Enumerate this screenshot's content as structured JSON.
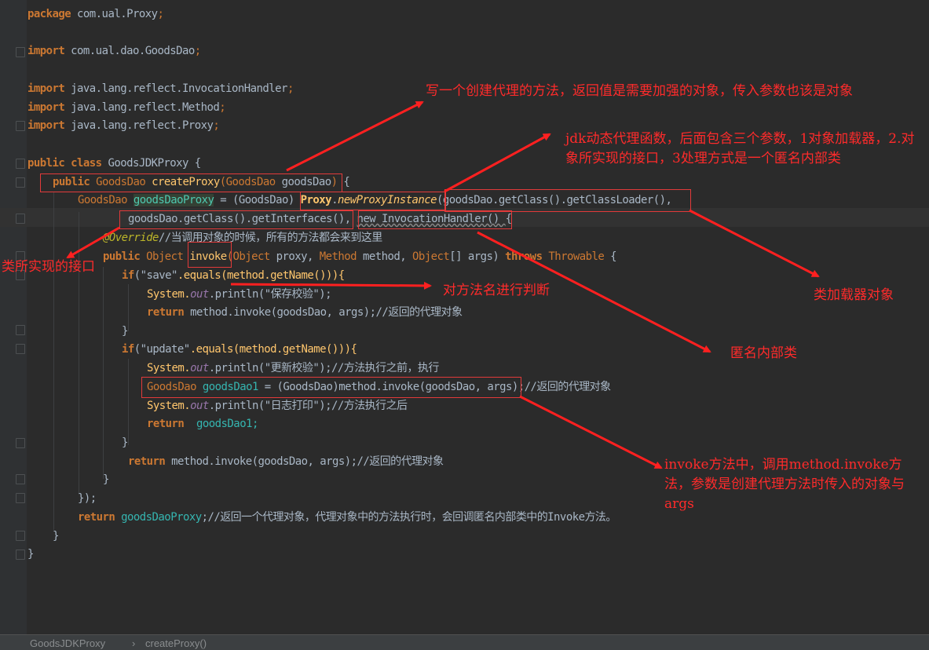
{
  "code": {
    "l1_kw": "package",
    "l1_pkg": "com.ual.Proxy",
    "l1_end": ";",
    "l2_kw": "import",
    "l2_pkg": "com.ual.dao.GoodsDao",
    "l2_end": ";",
    "l3_kw": "import",
    "l3_pkg": "java.lang.reflect.",
    "l3_cls": "InvocationHandler",
    "l3_end": ";",
    "l4_kw": "import",
    "l4_pkg": "java.lang.reflect.",
    "l4_cls": "Method",
    "l4_end": ";",
    "l5_kw": "import",
    "l5_pkg": "java.lang.reflect.",
    "l5_cls": "Proxy",
    "l5_end": ";",
    "l6_kw": "public class",
    "l6_name": "GoodsJDKProxy",
    "l6_end": " {",
    "l7_kw": "public",
    "l7_type": "GoodsDao",
    "l7_name": "createProxy",
    "l7_p1": "(GoodsDao ",
    "l7_p2": "goodsDao",
    "l7_end": ")",
    "l7_brace": " {",
    "l8_type": "GoodsDao ",
    "l8_var": "goodsDaoProxy",
    "l8_eq": " = (GoodsDao) ",
    "l8_proxy": "Proxy",
    "l8_dot": ".",
    "l8_mth": "newProxyInstance",
    "l8_args": "(goodsDao.getClass().getClassLoader(),",
    "l9_args": "goodsDao.getClass().getInterfaces(),",
    "l9_new": "new InvocationHandler() ",
    "l9_brace": "{",
    "l10_ann": "@Override",
    "l10_cmt": "//当调用对象的时候，所有的方法都会来到这里",
    "l11_kw1": "public",
    "l11_t": " Object ",
    "l11_name": "invoke",
    "l11_rest1": "(Object ",
    "l11_p1": "proxy, ",
    "l11_t2": "Method ",
    "l11_p2": "method, ",
    "l11_t3": "Object",
    "l11_p3": "[] args) ",
    "l11_kw2": "throws",
    "l11_t4": " Throwable",
    "l11_end": " {",
    "l12_kw": "if",
    "l12_str": "(\"save\"",
    "l12_rest": ".equals(method.getName())){",
    "l13_sys": "System.",
    "l13_out": "out",
    "l13_rest": ".println(\"保存校验\");",
    "l14_kw": "return",
    "l14_rest": " method.invoke(goodsDao, args);//返回的代理对象",
    "l15": "}",
    "l16_kw": "if",
    "l16_str": "(\"update\"",
    "l16_rest": ".equals(method.getName())){",
    "l17_sys": "System.",
    "l17_out": "out",
    "l17_rest": ".println(\"更新校验\");//方法执行之前，执行",
    "l18_a": "GoodsDao ",
    "l18_var": "goodsDao1",
    "l18_b": " = (GoodsDao)method.invoke(goodsDao, args)",
    "l18_c": ";//返回的代理对象",
    "l19_sys": "System.",
    "l19_out": "out",
    "l19_rest": ".println(\"日志打印\");//方法执行之后",
    "l20_kw": "return",
    "l20_rest": "  goodsDao1;",
    "l21": "}",
    "l22_kw": "return",
    "l22_rest": " method.invoke(goodsDao, args);//返回的代理对象",
    "l23": "}",
    "l24": "});",
    "l25_kw": "return",
    "l25_var": " goodsDaoProxy",
    "l25_rest": ";//返回一个代理对象，代理对象中的方法执行时，会回调匿名内部类中的Invoke方法。",
    "l26": "}",
    "l27": "}"
  },
  "annotations": {
    "a1": "写一个创建代理的方法，返回值是需要加强的对象，传入参数也该是对象",
    "a2": "jdk动态代理函数，后面包含三个参数，1对象加载器，2.对象所实现的接口，3处理方式是一个匿名内部类",
    "a3": "类所实现的接口",
    "a4": "对方法名进行判断",
    "a5": "类加载器对象",
    "a6": "匿名内部类",
    "a7": "invoke方法中，调用method.invoke方法，参数是创建代理方法时传入的对象与args"
  },
  "statusbar": {
    "crumb1": "GoodsJDKProxy",
    "sep": "›",
    "crumb2": "createProxy()"
  },
  "colors": {
    "background": "#2b2b2b",
    "keyword": "#cc7832",
    "annotation_red": "#ff2b2b"
  }
}
